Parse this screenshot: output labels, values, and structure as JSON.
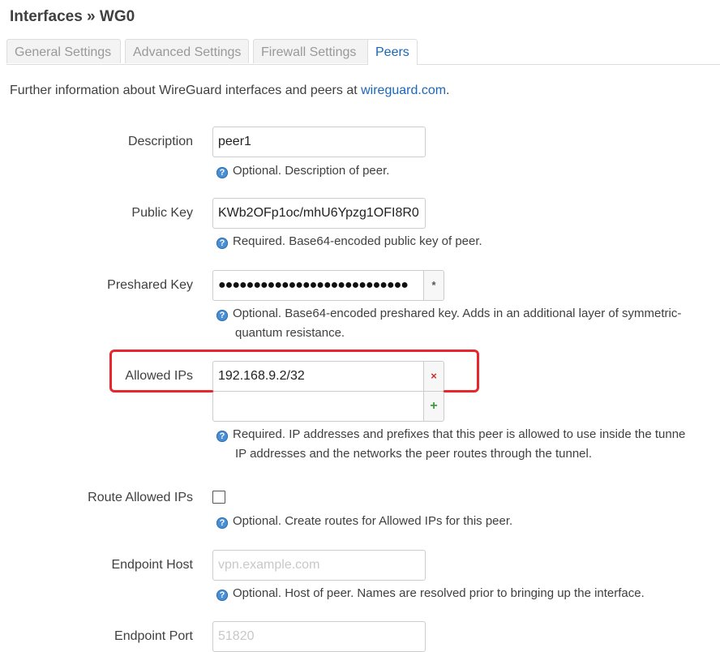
{
  "page": {
    "title": "Interfaces » WG0"
  },
  "tabs": [
    {
      "label": "General Settings"
    },
    {
      "label": "Advanced Settings"
    },
    {
      "label": "Firewall Settings"
    },
    {
      "label": "Peers"
    }
  ],
  "intro": {
    "text": "Further information about WireGuard interfaces and peers at ",
    "link": "wireguard.com",
    "suffix": "."
  },
  "fields": {
    "description": {
      "label": "Description",
      "value": "peer1",
      "help": "Optional. Description of peer."
    },
    "public_key": {
      "label": "Public Key",
      "value": "KWb2OFp1oc/mhU6Ypzg1OFI8R0",
      "help": "Required. Base64-encoded public key of peer."
    },
    "preshared_key": {
      "label": "Preshared Key",
      "value": "●●●●●●●●●●●●●●●●●●●●●●●●●●●",
      "reveal_icon": "*",
      "help_line1": "Optional. Base64-encoded preshared key. Adds in an additional layer of symmetric-",
      "help_line2": "quantum resistance."
    },
    "allowed_ips": {
      "label": "Allowed IPs",
      "values": [
        "192.168.9.2/32",
        ""
      ],
      "remove_icon": "×",
      "add_icon": "+",
      "help_line1": "Required. IP addresses and prefixes that this peer is allowed to use inside the tunne",
      "help_line2": "IP addresses and the networks the peer routes through the tunnel."
    },
    "route_allowed_ips": {
      "label": "Route Allowed IPs",
      "checked": false,
      "help": "Optional. Create routes for Allowed IPs for this peer."
    },
    "endpoint_host": {
      "label": "Endpoint Host",
      "placeholder": "vpn.example.com",
      "help": "Optional. Host of peer. Names are resolved prior to bringing up the interface."
    },
    "endpoint_port": {
      "label": "Endpoint Port",
      "placeholder": "51820"
    }
  },
  "help_icon": "?",
  "colors": {
    "link": "#1a66b8",
    "highlight": "#e8262d",
    "remove": "#c9302c",
    "add": "#3c9a3c"
  }
}
